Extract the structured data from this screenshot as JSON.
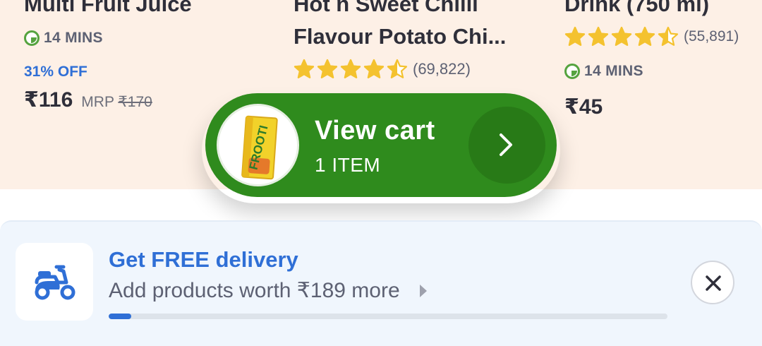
{
  "products": [
    {
      "name": "Multi Fruit Juice",
      "eta": "14 MINS",
      "discount": "31% OFF",
      "price": "₹116",
      "mrp_label": "MRP",
      "mrp_value": "₹170"
    },
    {
      "name_line1": "Hot n Sweet Chilli",
      "name_line2": "Flavour Potato Chi...",
      "rating": 4.5,
      "rating_count": "(69,822)"
    },
    {
      "name": "Drink (750 ml)",
      "rating": 4.5,
      "rating_count": "(55,891)",
      "eta": "14 MINS",
      "price": "₹45"
    }
  ],
  "cart": {
    "title": "View cart",
    "subtitle": "1 ITEM",
    "thumb_label": "FROOTI",
    "arrow_icon": "chevron-right-icon"
  },
  "delivery": {
    "title": "Get FREE delivery",
    "subtitle": "Add products worth ₹189 more",
    "progress": 0.04,
    "icon": "scooter-icon",
    "close_icon": "close-icon"
  },
  "colors": {
    "accent_blue": "#2f6fd6",
    "cart_green": "#2f8b1d",
    "star_yellow": "#f4c22f",
    "eta_green": "#55a33f"
  }
}
